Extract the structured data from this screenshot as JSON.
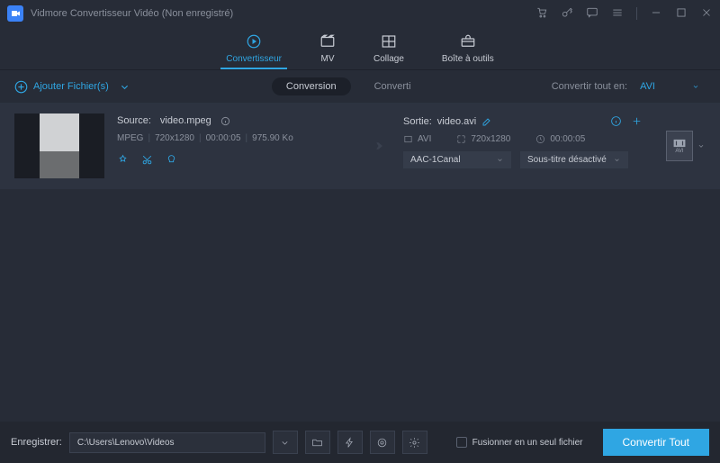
{
  "titlebar": {
    "title": "Vidmore Convertisseur Vidéo (Non enregistré)"
  },
  "tabs": {
    "convertisseur": "Convertisseur",
    "mv": "MV",
    "collage": "Collage",
    "boite": "Boîte à outils"
  },
  "toolbar": {
    "add_label": "Ajouter Fichier(s)",
    "conversion": "Conversion",
    "converti": "Converti",
    "convert_all_label": "Convertir tout en:",
    "convert_all_format": "AVI"
  },
  "file": {
    "source_prefix": "Source:",
    "source_name": "video.mpeg",
    "codec": "MPEG",
    "resolution": "720x1280",
    "duration": "00:00:05",
    "size": "975.90 Ko",
    "output_prefix": "Sortie:",
    "output_name": "video.avi",
    "out_format": "AVI",
    "out_resolution": "720x1280",
    "out_duration": "00:00:05",
    "audio_sel": "AAC-1Canal",
    "subtitle_sel": "Sous-titre désactivé",
    "fmt_box_label": "AVI"
  },
  "footer": {
    "save_label": "Enregistrer:",
    "path": "C:\\Users\\Lenovo\\Videos",
    "merge_label": "Fusionner en un seul fichier",
    "convert_all": "Convertir Tout"
  }
}
